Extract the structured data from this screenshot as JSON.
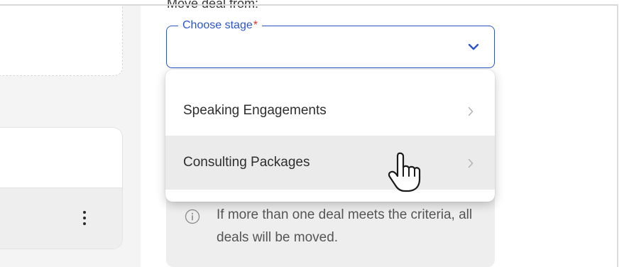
{
  "move_section": {
    "heading": "Move deal from:",
    "stage_select": {
      "label": "Choose stage",
      "required_marker": "*",
      "value": ""
    }
  },
  "dropdown": {
    "options": [
      {
        "label": "Speaking Engagements",
        "hovered": false
      },
      {
        "label": "Consulting Packages",
        "hovered": true
      }
    ]
  },
  "info_note": {
    "icon": "info-icon",
    "text": "If more than one deal meets the criteria, all deals will be moved."
  },
  "colors": {
    "accent": "#2b55c9",
    "required": "#dd3333",
    "hover_row": "#ebebeb",
    "info_bg": "#eeeeee"
  }
}
